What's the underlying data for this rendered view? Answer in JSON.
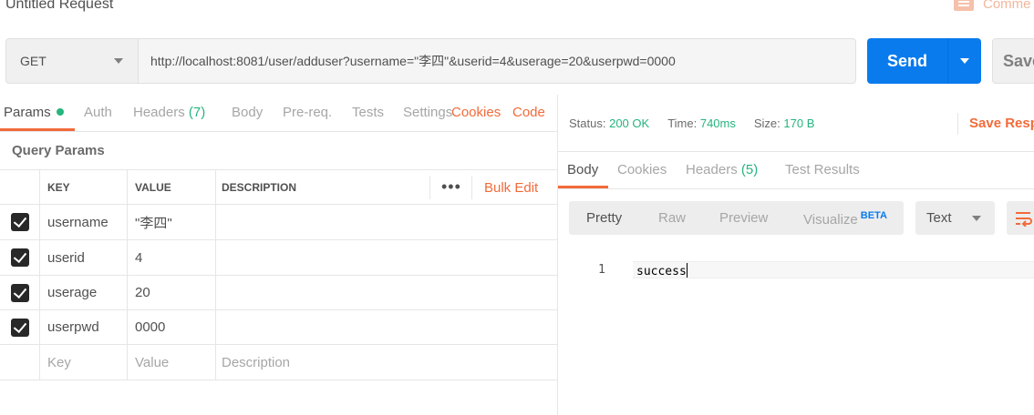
{
  "request": {
    "title": "Untitled Request",
    "comments_label": "Comme",
    "method": "GET",
    "url": "http://localhost:8081/user/adduser?username=\"李四\"&userid=4&userage=20&userpwd=0000",
    "send_label": "Send",
    "save_label": "Save"
  },
  "request_tabs": {
    "params": "Params",
    "auth": "Auth",
    "headers": "Headers",
    "headers_count": "(7)",
    "body": "Body",
    "prereq": "Pre-req.",
    "tests": "Tests",
    "settings": "Settings",
    "cookies": "Cookies",
    "code": "Code"
  },
  "query_params": {
    "title": "Query Params",
    "columns": [
      "KEY",
      "VALUE",
      "DESCRIPTION"
    ],
    "bulk_edit": "Bulk Edit",
    "more": "•••",
    "rows": [
      {
        "key": "username",
        "value": "\"李四\"",
        "description": ""
      },
      {
        "key": "userid",
        "value": "4",
        "description": ""
      },
      {
        "key": "userage",
        "value": "20",
        "description": ""
      },
      {
        "key": "userpwd",
        "value": "0000",
        "description": ""
      }
    ],
    "placeholders": {
      "key": "Key",
      "value": "Value",
      "description": "Description"
    }
  },
  "response": {
    "status_label": "Status:",
    "status_value": "200 OK",
    "time_label": "Time:",
    "time_value": "740ms",
    "size_label": "Size:",
    "size_value": "170 B",
    "save_response": "Save Resp",
    "tabs": {
      "body": "Body",
      "cookies": "Cookies",
      "headers": "Headers",
      "headers_count": "(5)",
      "test_results": "Test Results"
    },
    "views": {
      "pretty": "Pretty",
      "raw": "Raw",
      "preview": "Preview",
      "visualize": "Visualize",
      "beta": "BETA"
    },
    "format": "Text",
    "code": {
      "line_number": "1",
      "text": "success"
    }
  },
  "colors": {
    "accent": "#f26b3a",
    "send": "#097bed",
    "success": "#26b47f"
  }
}
